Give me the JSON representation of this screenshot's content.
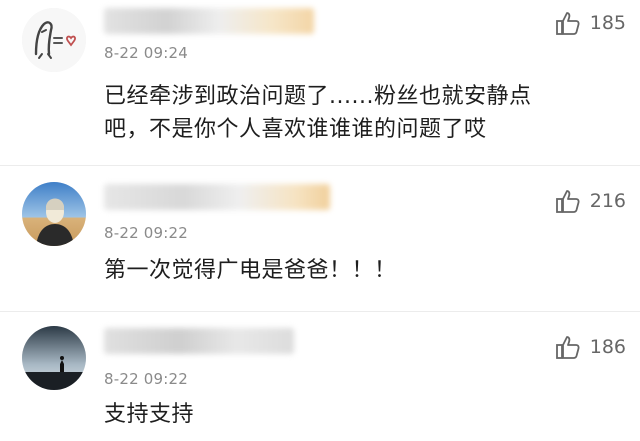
{
  "comments": [
    {
      "time": "8-22 09:24",
      "likes": "185",
      "text_lines": [
        "已经牵涉到政治问题了......粉丝也就安静点",
        "吧，不是你个人喜欢谁谁谁的问题了哎"
      ],
      "avatar_icon": "cartoon-doodle-avatar"
    },
    {
      "time": "8-22 09:22",
      "likes": "216",
      "text_lines": [
        "第一次觉得广电是爸爸！！！"
      ],
      "avatar_icon": "person-photo-avatar"
    },
    {
      "time": "8-22 09:22",
      "likes": "186",
      "text_lines": [
        "支持支持"
      ],
      "avatar_icon": "silhouette-landscape-avatar"
    }
  ],
  "like_icon": "thumbs-up-icon",
  "colors": {
    "time_text": "#8a8a8a",
    "like_text": "#666666",
    "comment_text": "#1e1e1e",
    "name_blur_warm": "#f6d9b0",
    "name_blur_gray": "#d6d6d6"
  }
}
